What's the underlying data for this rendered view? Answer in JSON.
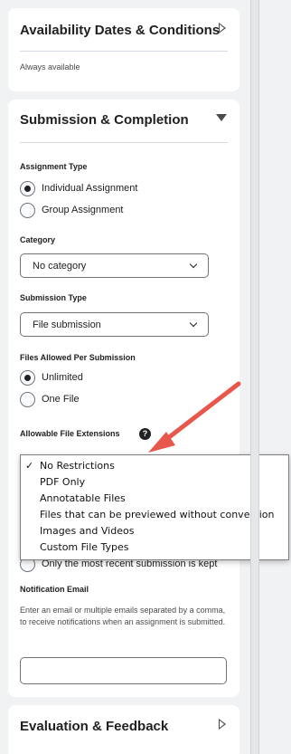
{
  "availability": {
    "title": "Availability Dates & Conditions",
    "status": "Always available"
  },
  "submission": {
    "title": "Submission & Completion",
    "assignment_type": {
      "label": "Assignment Type",
      "options": [
        "Individual Assignment",
        "Group Assignment"
      ],
      "selected": "Individual Assignment"
    },
    "category": {
      "label": "Category",
      "value": "No category"
    },
    "submission_type": {
      "label": "Submission Type",
      "value": "File submission"
    },
    "files_allowed": {
      "label": "Files Allowed Per Submission",
      "options": [
        "Unlimited",
        "One File"
      ],
      "selected": "Unlimited"
    },
    "allowable_extensions": {
      "label": "Allowable File Extensions",
      "help_icon": "question-circle-icon",
      "options": [
        "No Restrictions",
        "PDF Only",
        "Annotatable Files",
        "Files that can be previewed without conversion",
        "Images and Videos",
        "Custom File Types"
      ],
      "selected": "No Restrictions",
      "check_mark": "✓"
    },
    "kept_option": "Only the most recent submission is kept",
    "notification": {
      "label": "Notification Email",
      "description": "Enter an email or multiple emails separated by a comma, to receive notifications when an assignment is submitted.",
      "value": ""
    }
  },
  "evaluation": {
    "title": "Evaluation & Feedback"
  },
  "colors": {
    "annotation_arrow": "#e8574c",
    "panel_bg": "#ffffff",
    "page_bg": "#f1f2f4"
  }
}
